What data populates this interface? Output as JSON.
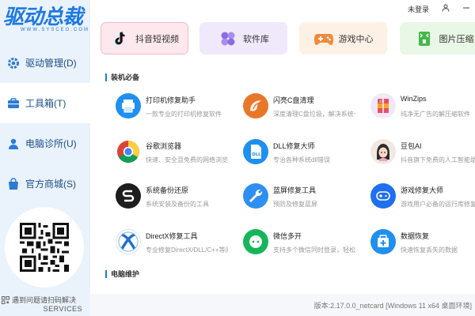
{
  "app": {
    "logo_text": "驱动总裁",
    "logo_sub": "WWW.SYSCEO.COM"
  },
  "topbar": {
    "login": "未登录"
  },
  "sidebar": {
    "items": [
      {
        "label": "驱动管理(D)",
        "icon": "gear-icon"
      },
      {
        "label": "工具箱(T)",
        "icon": "toolbox-icon"
      },
      {
        "label": "电脑诊所(U)",
        "icon": "person-icon"
      },
      {
        "label": "官方商城(S)",
        "icon": "shopping-bag-icon"
      }
    ],
    "qr_tip": "遇到问题请扫码解决",
    "services": "SERVICES"
  },
  "tabs": [
    {
      "label": "抖音短视频",
      "icon": "tiktok-icon"
    },
    {
      "label": "软件库",
      "icon": "clover-icon"
    },
    {
      "label": "游戏中心",
      "icon": "gamepad-icon"
    },
    {
      "label": "图片压缩",
      "icon": "image-compress-icon"
    }
  ],
  "sections": {
    "essentials": "装机必备",
    "maintenance": "电脑维护"
  },
  "tools": [
    {
      "name": "打印机修复助手",
      "desc": "一款专业的打印机修复软件",
      "icon": "printer-icon",
      "color": "#1f8ff0"
    },
    {
      "name": "闪亮C盘清理",
      "desc": "深度清理C盘垃圾，解决系统卡顿",
      "icon": "swirl-icon",
      "color": "#e8772a"
    },
    {
      "name": "WinZips",
      "desc": "纯净无广告的解压缩软件",
      "icon": "zip-icon",
      "color": "#e9e3f3"
    },
    {
      "name": "谷歌浏览器",
      "desc": "快速、安全且免费的网络浏览器",
      "icon": "chrome-icon",
      "color": "#ffffff"
    },
    {
      "name": "DLL修复大师",
      "desc": "专治各种系统dll错误",
      "icon": "dll-icon",
      "color": "#1f8ff0"
    },
    {
      "name": "豆包AI",
      "desc": "抖音旗下免费的人工智能助手",
      "icon": "avatar-icon",
      "color": "#f1e8e2"
    },
    {
      "name": "系统备份还原",
      "desc": "系统安装及备份的工具",
      "icon": "backup-s-icon",
      "color": "#1d1d1d"
    },
    {
      "name": "蓝屏修复工具",
      "desc": "预防及修复蓝屏",
      "icon": "wrench-icon",
      "color": "#2f8ef2"
    },
    {
      "name": "游戏修复大师",
      "desc": "游戏用户必备的运行库修复工具",
      "icon": "game-controller-icon",
      "color": "#1f6ff0"
    },
    {
      "name": "DirectX修复工具",
      "desc": "专业修复DirectX/DLL/C++等问题",
      "icon": "directx-icon",
      "color": "#ffffff"
    },
    {
      "name": "微信多开",
      "desc": "支持多个微信同时登录，轻松切换",
      "icon": "wechat-multi-icon",
      "color": "#17b55a"
    },
    {
      "name": "数据恢复",
      "desc": "快速恢复丢失的数据",
      "icon": "data-recovery-icon",
      "color": "#1f8ff0"
    }
  ],
  "status": {
    "version": "版本:2.17.0.0_netcard [Windows 11 x64 桌面环境]"
  }
}
